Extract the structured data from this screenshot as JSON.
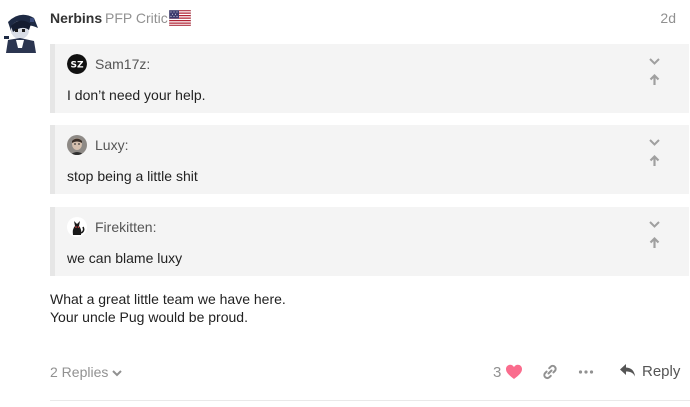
{
  "post": {
    "author": {
      "username": "Nerbins",
      "user_title": "PFP Critic",
      "flag_icon": "us-flag-icon"
    },
    "date": "2d",
    "quotes": [
      {
        "author": "Sam17z:",
        "text": "I don’t need your help.",
        "avatar_icon": "sz-logo-avatar"
      },
      {
        "author": "Luxy:",
        "text": "stop being a little shit",
        "avatar_icon": "face-photo-avatar"
      },
      {
        "author": "Firekitten:",
        "text": "we can blame luxy",
        "avatar_icon": "cat-silhouette-avatar"
      }
    ],
    "body_lines": [
      "What a great little team we have here.",
      "Your uncle Pug would be proud."
    ],
    "footer": {
      "replies_label": "2 Replies",
      "like_count": "3",
      "reply_label": "Reply"
    }
  },
  "colors": {
    "quote_bg": "#f4f4f4",
    "muted_text": "#919191",
    "heart": "#fa6c8d"
  }
}
